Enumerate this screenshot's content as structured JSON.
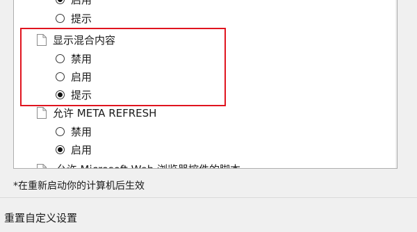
{
  "settings_tree": {
    "rows": [
      {
        "type": "radio",
        "label": "启用",
        "checked": true
      },
      {
        "type": "radio",
        "label": "提示",
        "checked": false
      },
      {
        "type": "group",
        "label": "显示混合内容"
      },
      {
        "type": "radio",
        "label": "禁用",
        "checked": false
      },
      {
        "type": "radio",
        "label": "启用",
        "checked": false
      },
      {
        "type": "radio",
        "label": "提示",
        "checked": true
      },
      {
        "type": "group",
        "label": "允许 META REFRESH"
      },
      {
        "type": "radio",
        "label": "禁用",
        "checked": false
      },
      {
        "type": "radio",
        "label": "启用",
        "checked": true
      }
    ],
    "clipped_row_label": "允许 Microsoft Web 浏览器控件的脚本"
  },
  "restart_note": "*在重新启动你的计算机后生效",
  "reset_section_title": "重置自定义设置",
  "colors": {
    "highlight_border": "#e0141e"
  },
  "icons": {
    "group": "page-icon",
    "scroll_down": "chevron-down-icon"
  }
}
